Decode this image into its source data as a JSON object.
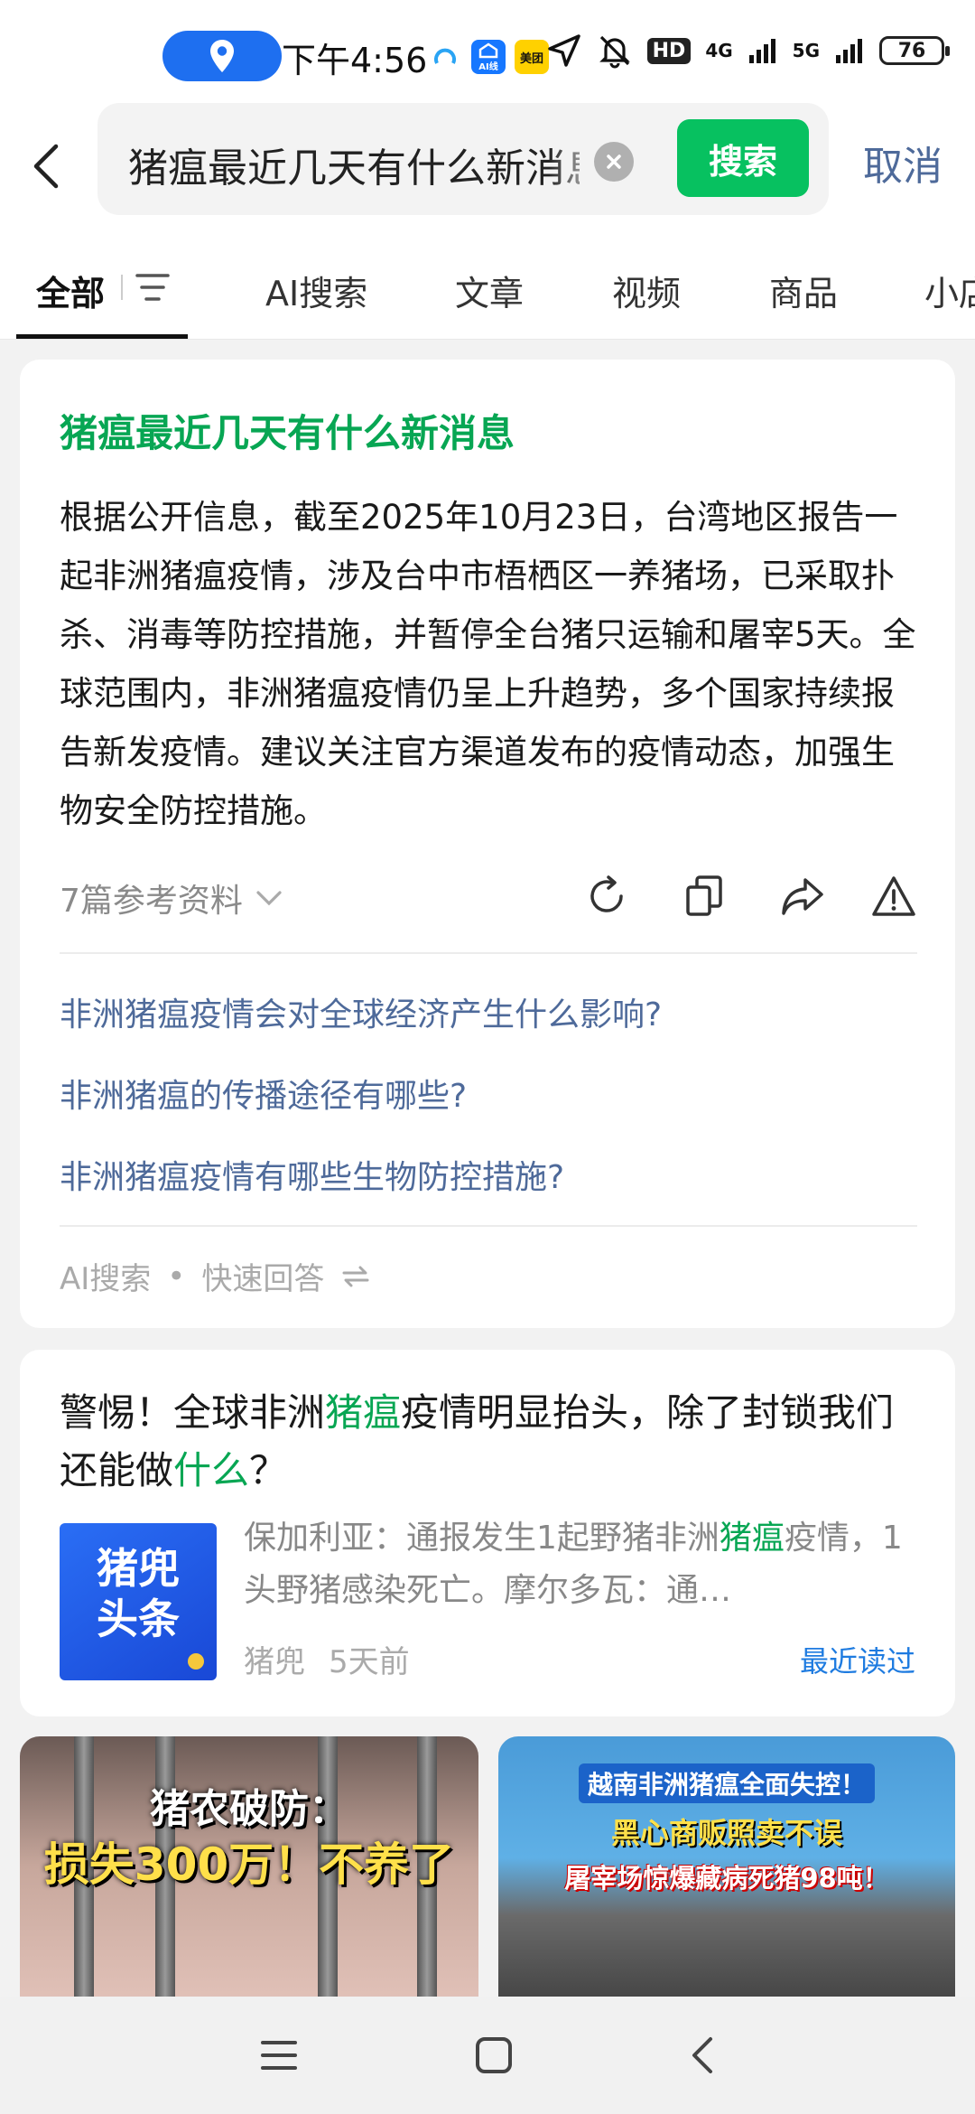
{
  "status_bar": {
    "time": "下午4:56",
    "app_icons": [
      {
        "name": "ai-app-icon",
        "label": "AI线"
      },
      {
        "name": "meituan-app-icon",
        "label": "美团"
      }
    ],
    "hd_label": "HD",
    "network_1": "4G",
    "network_2": "5G",
    "battery": "76"
  },
  "search": {
    "query": "猪瘟最近几天有什么新消息",
    "button_label": "搜索",
    "cancel_label": "取消"
  },
  "tabs": {
    "all": "全部",
    "ai_search": "AI搜索",
    "articles": "文章",
    "videos": "视频",
    "products": "商品",
    "mini": "小店"
  },
  "ai_answer": {
    "title": "猪瘟最近几天有什么新消息",
    "body": "根据公开信息，截至2025年10月23日，台湾地区报告一起非洲猪瘟疫情，涉及台中市梧栖区一养猪场，已采取扑杀、消毒等防控措施，并暂停全台猪只运输和屠宰5天。全球范围内，非洲猪瘟疫情仍呈上升趋势，多个国家持续报告新发疫情。建议关注官方渠道发布的疫情动态，加强生物安全防控措施。",
    "references": "7篇参考资料",
    "related": [
      "非洲猪瘟疫情会对全球经济产生什么影响?",
      "非洲猪瘟的传播途径有哪些?",
      "非洲猪瘟疫情有哪些生物防控措施?"
    ],
    "footer_source": "AI搜索",
    "footer_mode": "快速回答"
  },
  "news": {
    "title_parts": [
      "警惕！全球非洲",
      "猪瘟",
      "疫情明显抬头，除了封锁我们还能做",
      "什么",
      "？"
    ],
    "thumb_text": [
      "猪兜",
      "头条"
    ],
    "snippet_parts": [
      "保加利亚：通报发生1起野猪非洲",
      "猪瘟",
      "疫情，1头野猪感染死亡。摩尔多瓦：通…"
    ],
    "source": "猪兜",
    "time": "5天前",
    "recent_read": "最近读过"
  },
  "videos": [
    {
      "caption_1": "猪农破防：",
      "caption_2": "损失300万！不养了"
    },
    {
      "line_1": "越南非洲猪瘟全面失控！",
      "line_2": "黑心商贩照卖不误",
      "line_3": "屠宰场惊爆藏病死猪98吨！"
    }
  ],
  "colors": {
    "accent_green": "#07c160",
    "title_green": "#07a653",
    "link_blue": "#4e6a9a",
    "recent_blue": "#1e7be0"
  }
}
